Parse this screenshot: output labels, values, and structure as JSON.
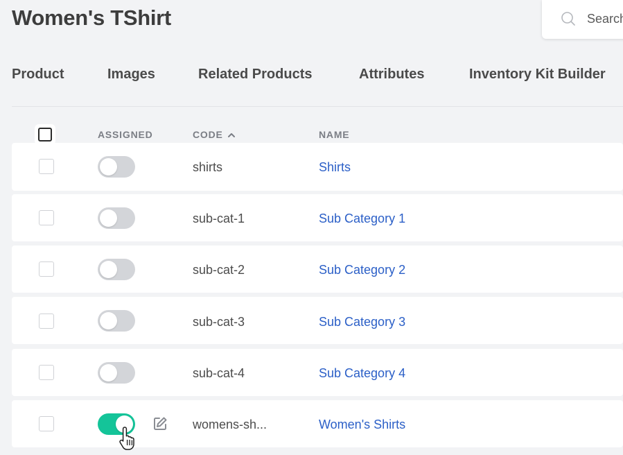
{
  "header": {
    "title": "Women's TShirt",
    "search": {
      "placeholder": "Search",
      "value": ""
    }
  },
  "tabs": [
    {
      "label": "Product"
    },
    {
      "label": "Images"
    },
    {
      "label": "Related Products"
    },
    {
      "label": "Attributes"
    },
    {
      "label": "Inventory Kit Builder"
    }
  ],
  "table": {
    "columns": {
      "assigned": "ASSIGNED",
      "code": "CODE",
      "name": "NAME"
    },
    "sort": {
      "column": "code",
      "direction": "ascending"
    },
    "rows": [
      {
        "code": "shirts",
        "name": "Shirts",
        "assigned": false,
        "checked": false
      },
      {
        "code": "sub-cat-1",
        "name": "Sub Category 1",
        "assigned": false,
        "checked": false
      },
      {
        "code": "sub-cat-2",
        "name": "Sub Category 2",
        "assigned": false,
        "checked": false
      },
      {
        "code": "sub-cat-3",
        "name": "Sub Category 3",
        "assigned": false,
        "checked": false
      },
      {
        "code": "sub-cat-4",
        "name": "Sub Category 4",
        "assigned": false,
        "checked": false
      },
      {
        "code": "womens-sh...",
        "name": "Women's Shirts",
        "assigned": true,
        "checked": false,
        "has_edit_icon": true
      }
    ]
  },
  "colors": {
    "accent_toggle_on": "#14c499",
    "toggle_off": "#d3d5d9",
    "link": "#2b5fc7",
    "background": "#f2f3f5"
  },
  "icons": [
    "search-icon",
    "sort-ascending-icon",
    "edit-icon",
    "pointer-cursor-icon"
  ]
}
